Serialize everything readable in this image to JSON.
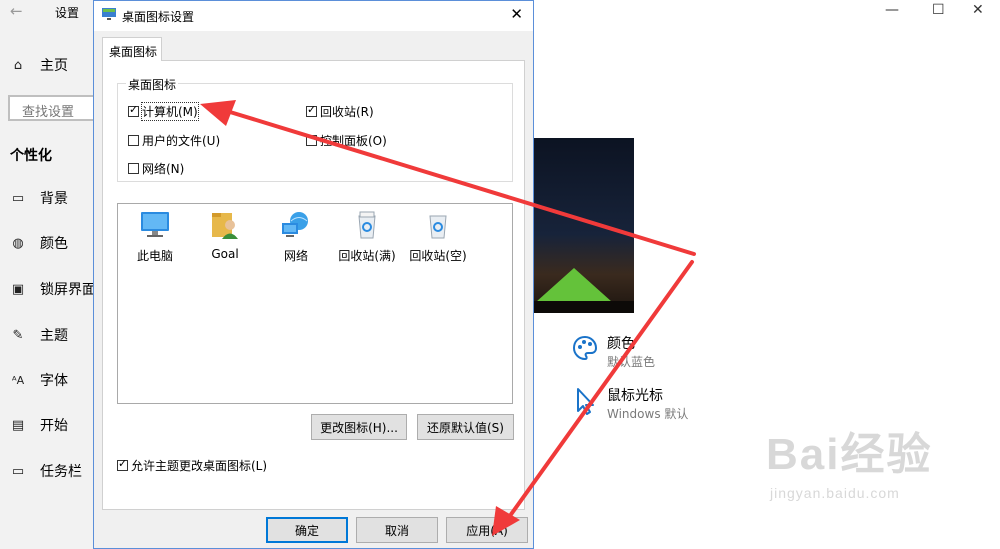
{
  "settings": {
    "title": "设置",
    "search_placeholder": "查找设置",
    "home_label": "主页",
    "section_title": "个性化",
    "nav": [
      {
        "label": "背景",
        "icon": "picture-icon"
      },
      {
        "label": "颜色",
        "icon": "palette-icon"
      },
      {
        "label": "锁屏界面",
        "icon": "lockscreen-icon"
      },
      {
        "label": "主题",
        "icon": "theme-icon"
      },
      {
        "label": "字体",
        "icon": "font-icon"
      },
      {
        "label": "开始",
        "icon": "start-icon"
      },
      {
        "label": "任务栏",
        "icon": "taskbar-icon"
      }
    ],
    "related": [
      {
        "title": "颜色",
        "subtitle": "默认蓝色",
        "icon": "palette-icon"
      },
      {
        "title": "鼠标光标",
        "subtitle": "Windows 默认",
        "icon": "cursor-icon"
      }
    ]
  },
  "dialog": {
    "title": "桌面图标设置",
    "tab": "桌面图标",
    "group_title": "桌面图标",
    "checkboxes": [
      {
        "label": "计算机(M)",
        "checked": true
      },
      {
        "label": "回收站(R)",
        "checked": true
      },
      {
        "label": "用户的文件(U)",
        "checked": false
      },
      {
        "label": "控制面板(O)",
        "checked": false
      },
      {
        "label": "网络(N)",
        "checked": false
      }
    ],
    "icons": [
      {
        "name": "此电脑",
        "icon": "computer-icon"
      },
      {
        "name": "Goal",
        "icon": "user-folder-icon"
      },
      {
        "name": "网络",
        "icon": "network-icon"
      },
      {
        "name": "回收站(满)",
        "icon": "recycle-bin-full-icon"
      },
      {
        "name": "回收站(空)",
        "icon": "recycle-bin-empty-icon"
      }
    ],
    "change_icon_button": "更改图标(H)...",
    "restore_default_button": "还原默认值(S)",
    "allow_themes_checkbox": {
      "label": "允许主题更改桌面图标(L)",
      "checked": true
    },
    "ok_button": "确定",
    "cancel_button": "取消",
    "apply_button": "应用(A)"
  },
  "watermark": {
    "brand": "Bai经验",
    "url": "jingyan.baidu.com"
  },
  "colors": {
    "arrow": "#f03a3a",
    "focus_blue": "#0078d7",
    "accent_icon": "#1a73c9"
  }
}
